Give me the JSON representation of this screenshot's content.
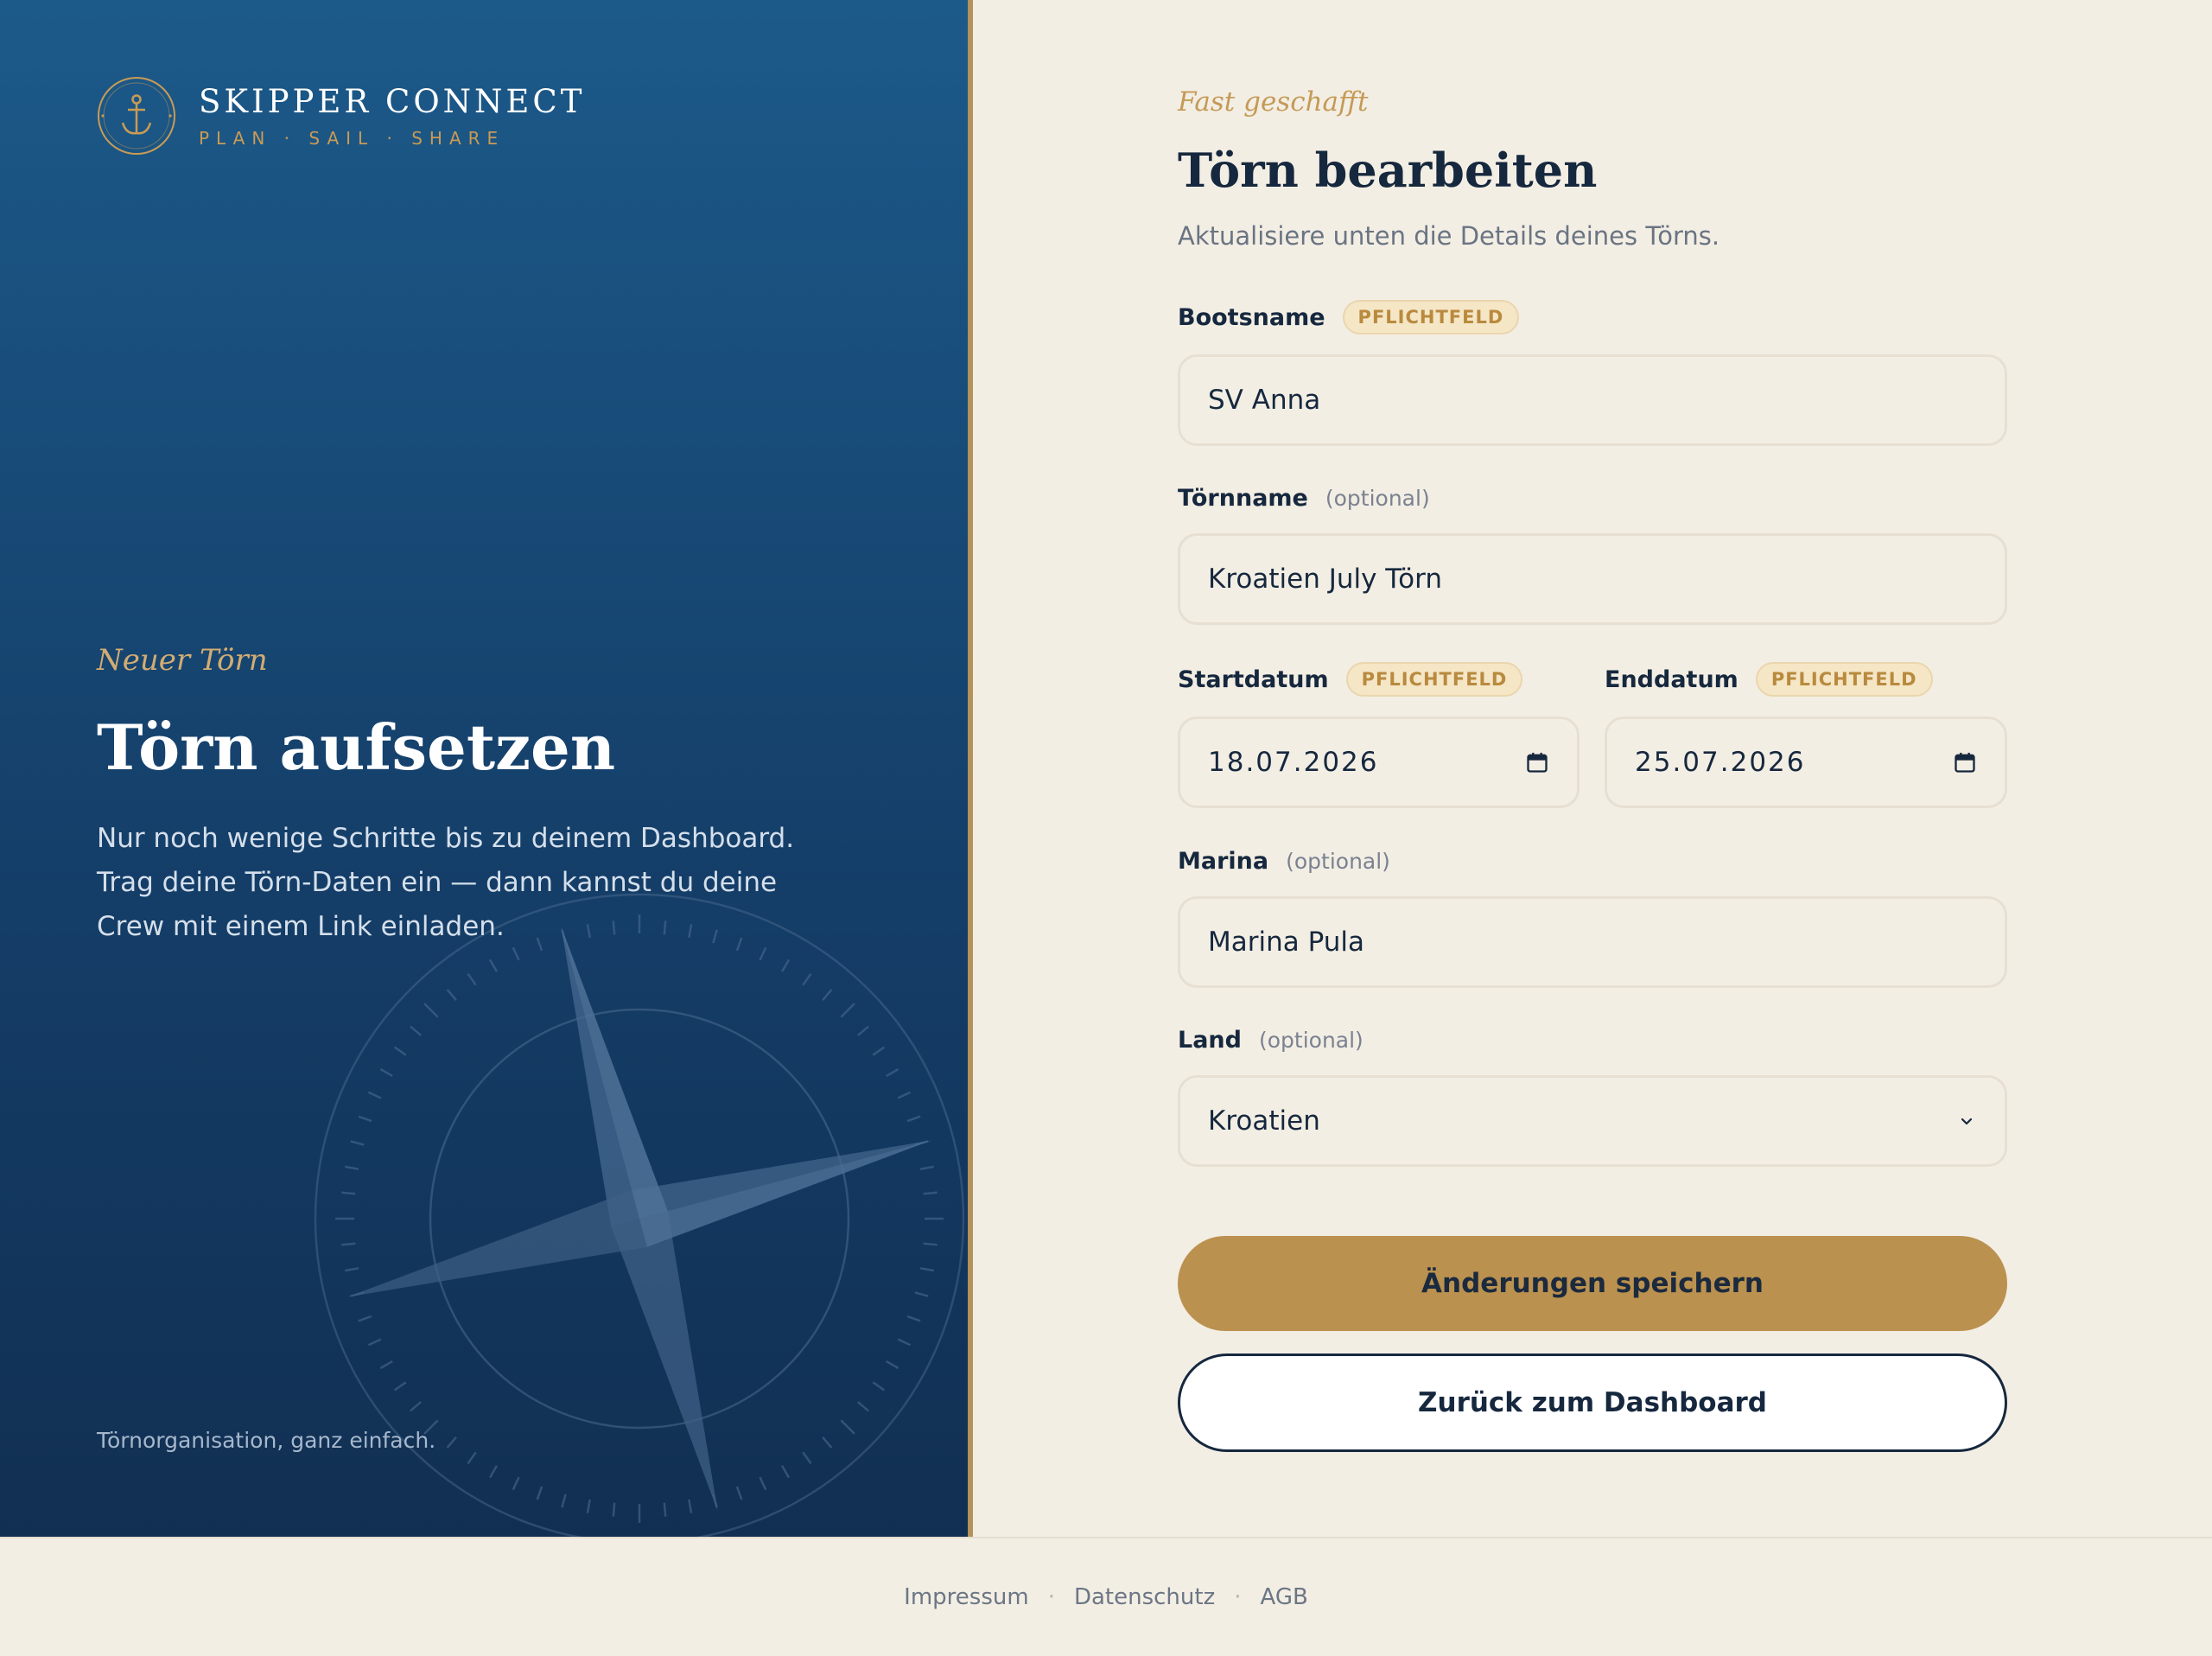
{
  "brand": {
    "name": "SKIPPER CONNECT",
    "tagline": "PLAN · SAIL · SHARE"
  },
  "hero": {
    "eyebrow": "Neuer Törn",
    "title": "Törn aufsetzen",
    "description": "Nur noch wenige Schritte bis zu deinem Dashboard. Trag deine Törn-Daten ein — dann kannst du deine Crew mit einem Link einladen.",
    "footnote": "Törnorganisation, ganz einfach."
  },
  "form": {
    "eyebrow": "Fast geschafft",
    "title": "Törn bearbeiten",
    "subtitle": "Aktualisiere unten die Details deines Törns.",
    "boat_name": {
      "label": "Bootsname",
      "badge": "PFLICHTFELD",
      "value": "SV Anna"
    },
    "trip_name": {
      "label": "Törnname",
      "hint": "(optional)",
      "value": "Kroatien July Törn"
    },
    "start_date": {
      "label": "Startdatum",
      "badge": "PFLICHTFELD",
      "value": "18.07.2026"
    },
    "end_date": {
      "label": "Enddatum",
      "badge": "PFLICHTFELD",
      "value": "25.07.2026"
    },
    "marina": {
      "label": "Marina",
      "hint": "(optional)",
      "value": "Marina Pula"
    },
    "country": {
      "label": "Land",
      "hint": "(optional)",
      "value": "Kroatien"
    },
    "save_label": "Änderungen speichern",
    "back_label": "Zurück zum Dashboard"
  },
  "footer": {
    "links": [
      "Impressum",
      "Datenschutz",
      "AGB"
    ],
    "separator": "·"
  },
  "colors": {
    "navy": "#16283e",
    "gold": "#bb914f",
    "cream": "#f3eee4",
    "panel_blue": "#1c5a8a"
  }
}
